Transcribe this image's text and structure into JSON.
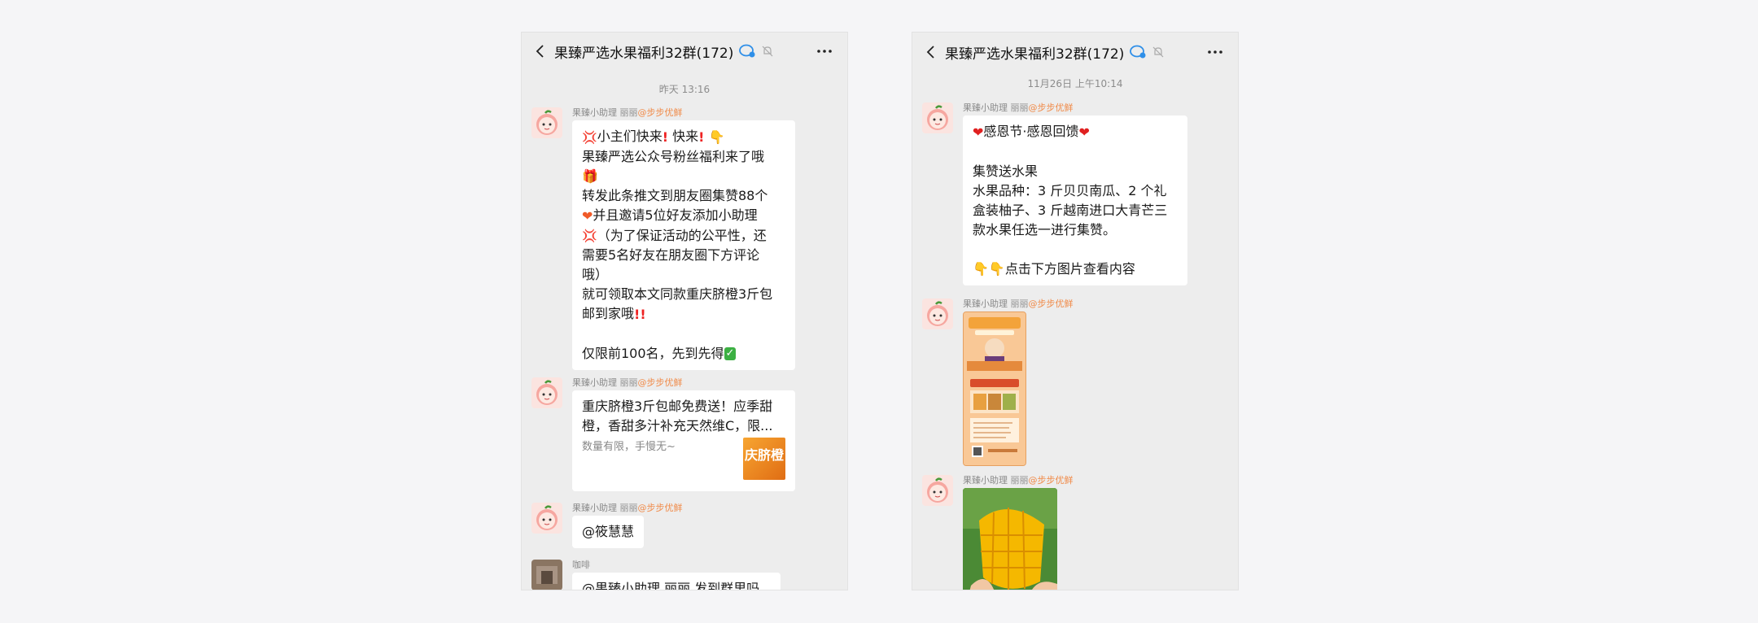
{
  "left": {
    "title": "果臻严选水果福利32群(172)",
    "timestamp": "昨天 13:16",
    "messages": [
      {
        "sender_name": "果臻小助理 丽丽",
        "sender_org": "@步步优鲜",
        "lines": [
          "小主们快来",
          "快来",
          "果臻严选公众号粉丝福利来了哦",
          "转发此条推文到朋友圈集赞88个",
          "并且邀请5位好友添加小助理",
          "（为了保证活动的公平性，还",
          "需要5名好友在朋友圈下方评论",
          "哦）",
          "就可领取本文同款重庆脐橙3斤包",
          "邮到家哦",
          "仅限前100名，先到先得"
        ]
      },
      {
        "sender_name": "果臻小助理 丽丽",
        "sender_org": "@步步优鲜",
        "card_title_1": "重庆脐橙3斤包邮免费送！应季甜",
        "card_title_2": "橙，香甜多汁补充天然维C，限...",
        "card_desc": "数量有限，手慢无~",
        "card_thumb_text": "庆脐橙"
      },
      {
        "sender_name": "果臻小助理 丽丽",
        "sender_org": "@步步优鲜",
        "text": "@筱慧慧"
      },
      {
        "sender_name": "咖啡",
        "text": "@果臻小助理 丽丽  发到群里吗"
      }
    ]
  },
  "right": {
    "title": "果臻严选水果福利32群(172)",
    "timestamp": "11月26日 上午10:14",
    "messages": [
      {
        "sender_name": "果臻小助理 丽丽",
        "sender_org": "@步步优鲜",
        "lines": [
          "感恩节·感恩回馈",
          "集赞送水果",
          "水果品种：3 斤贝贝南瓜、2 个礼",
          "盒装柚子、3 斤越南进口大青芒三",
          "款水果任选一进行集赞。",
          "点击下方图片查看内容"
        ]
      },
      {
        "sender_name": "果臻小助理 丽丽",
        "sender_org": "@步步优鲜"
      },
      {
        "sender_name": "果臻小助理 丽丽",
        "sender_org": "@步步优鲜"
      }
    ]
  },
  "colors": {
    "bubble": "#ffffff",
    "background": "#ededed",
    "sender_org": "#f08a48"
  }
}
